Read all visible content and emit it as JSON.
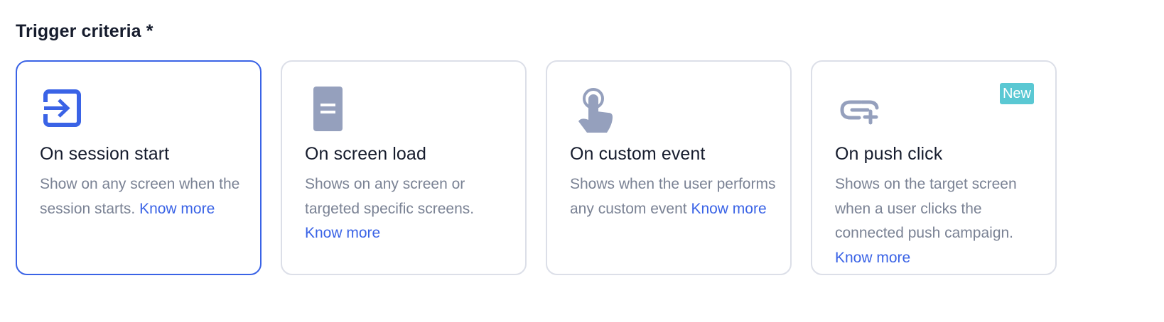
{
  "section": {
    "label": "Trigger criteria *"
  },
  "cards": [
    {
      "title": "On session start",
      "description": "Show on any screen when the session starts.",
      "link": "Know more",
      "icon": "enter-icon",
      "selected": true
    },
    {
      "title": "On screen load",
      "description": "Shows on any screen or targeted specific screens.",
      "link": "Know more",
      "icon": "screen-icon",
      "selected": false
    },
    {
      "title": "On custom event",
      "description": "Shows when the user performs any custom event",
      "link": "Know more",
      "icon": "tap-hand-icon",
      "selected": false
    },
    {
      "title": "On push click",
      "description": "Shows on the target screen when a user clicks the connected push campaign.",
      "link": "Know more",
      "icon": "link-add-icon",
      "badge": "New",
      "selected": false
    }
  ],
  "colors": {
    "accent": "#3a63e6",
    "icon_muted": "#95a0bd",
    "badge": "#5ac8d3",
    "border": "#dcdfe8",
    "text_muted": "#7a8294"
  }
}
